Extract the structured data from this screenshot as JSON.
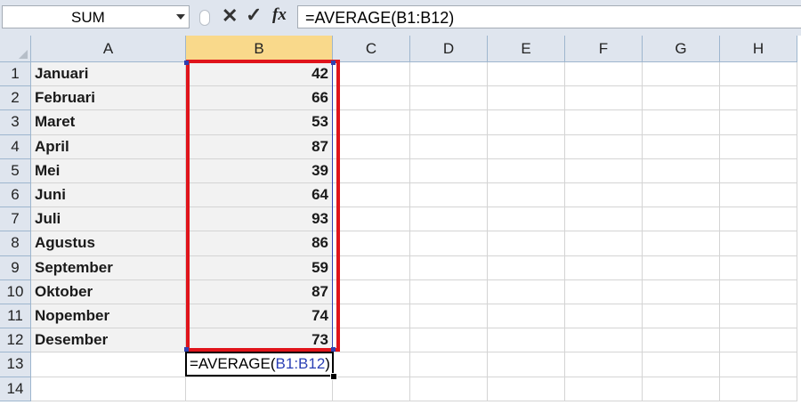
{
  "formula_bar": {
    "name_box": "SUM",
    "cancel_icon": "x-icon",
    "enter_icon": "check-icon",
    "fx_label": "fx",
    "formula": "=AVERAGE(B1:B12)"
  },
  "columns": [
    "A",
    "B",
    "C",
    "D",
    "E",
    "F",
    "G",
    "H"
  ],
  "rows": [
    "1",
    "2",
    "3",
    "4",
    "5",
    "6",
    "7",
    "8",
    "9",
    "10",
    "11",
    "12",
    "13",
    "14"
  ],
  "data_rows": [
    {
      "month": "Januari",
      "value": "42"
    },
    {
      "month": "Februari",
      "value": "66"
    },
    {
      "month": "Maret",
      "value": "53"
    },
    {
      "month": "April",
      "value": "87"
    },
    {
      "month": "Mei",
      "value": "39"
    },
    {
      "month": "Juni",
      "value": "64"
    },
    {
      "month": "Juli",
      "value": "93"
    },
    {
      "month": "Agustus",
      "value": "86"
    },
    {
      "month": "September",
      "value": "59"
    },
    {
      "month": "Oktober",
      "value": "87"
    },
    {
      "month": "Nopember",
      "value": "74"
    },
    {
      "month": "Desember",
      "value": "73"
    }
  ],
  "active_cell": {
    "address": "B13",
    "prefix": "=AVERAGE(",
    "ref": "B1:B12",
    "suffix": ")"
  },
  "colors": {
    "highlight": "#e0141b",
    "range_ref": "#2a3fb5",
    "selected_header": "#f9d98b"
  }
}
